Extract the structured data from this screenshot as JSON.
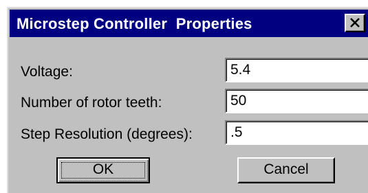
{
  "window": {
    "title": "Microstep Controller  Properties",
    "close_icon": "close-icon"
  },
  "form": {
    "voltage": {
      "label": "Voltage:",
      "value": "5.4"
    },
    "rotor_teeth": {
      "label": "Number of rotor teeth:",
      "value": "50"
    },
    "step_resolution": {
      "label": "Step Resolution (degrees):",
      "value": ".5"
    }
  },
  "buttons": {
    "ok_label": "OK",
    "cancel_label": "Cancel"
  },
  "colors": {
    "titlebar": "#000080",
    "face": "#c0c0c0"
  }
}
